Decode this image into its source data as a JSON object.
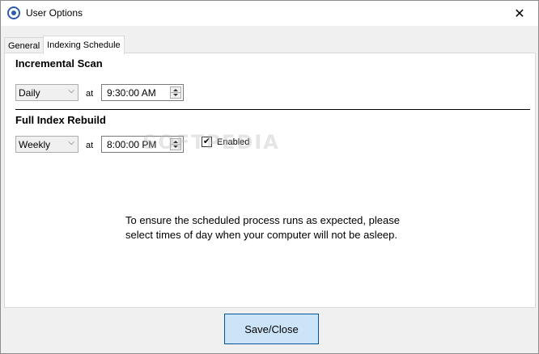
{
  "window": {
    "title": "User Options",
    "close_glyph": "✕",
    "app_icon": "app-logo-icon"
  },
  "tabs": [
    {
      "label": "General",
      "active": false
    },
    {
      "label": "Indexing Schedule",
      "active": true
    }
  ],
  "incremental": {
    "heading": "Incremental Scan",
    "frequency": "Daily",
    "at_label": "at",
    "time": "9:30:00 AM"
  },
  "full_rebuild": {
    "heading": "Full Index Rebuild",
    "frequency": "Weekly",
    "at_label": "at",
    "time": "8:00:00 PM",
    "enabled_label": "Enabled",
    "enabled_checked": true
  },
  "watermark": "SOFTPEDIA",
  "notice": {
    "line1": "To ensure the scheduled process runs as expected, please",
    "line2": "select times of day when your computer will not be asleep."
  },
  "footer": {
    "save_label": "Save/Close"
  },
  "colors": {
    "accent": "#cce4f7",
    "accent_border": "#005499"
  }
}
